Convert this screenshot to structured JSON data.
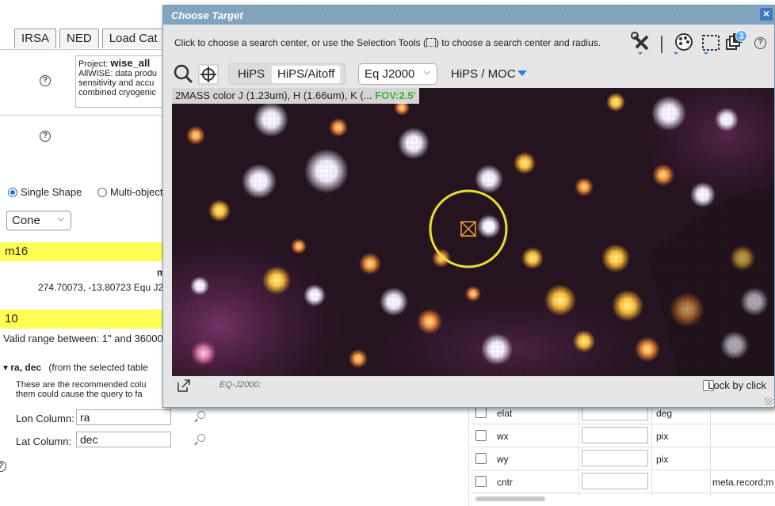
{
  "background": {
    "tabs": [
      "IRSA",
      "NED",
      "Load Cat"
    ],
    "project_label": "Project:",
    "project_name": "wise_all",
    "project_desc": "AllWISE: data produ sensitivity and accu combined cryogenic",
    "shape_options": [
      "Single Shape",
      "Multi-object"
    ],
    "shape_selected": "Single Shape",
    "cone_select": "Cone",
    "target_value": "m16",
    "resolved_m": "m",
    "resolved_coords": "274.70073, -13.80723  Equ J20",
    "radius_value": "10",
    "radius_range": "Valid range between: 1\" and 360000",
    "radec_heading": "ra, dec",
    "radec_note": "(from the selected table",
    "recommended_text_1": "These are the recommended colu",
    "recommended_text_2": "them could cause the query to fa",
    "lon_label": "Lon Column:",
    "lon_value": "ra",
    "lat_label": "Lat Column:",
    "lat_value": "dec",
    "table_rows": [
      {
        "name": "elat",
        "unit": "deg",
        "desc": ""
      },
      {
        "name": "wx",
        "unit": "pix",
        "desc": ""
      },
      {
        "name": "wy",
        "unit": "pix",
        "desc": ""
      },
      {
        "name": "cntr",
        "unit": "",
        "desc": "meta.record;m"
      }
    ]
  },
  "dialog": {
    "title": "Choose Target",
    "close": "×",
    "instructions_before": "Click to choose a search center, or use the Selection Tools (",
    "instructions_after": ") to choose a search center and radius.",
    "layers_badge": "3",
    "help": "?",
    "hips_buttons": [
      "HiPS",
      "HiPS/Aitoff"
    ],
    "hips_selected": "HiPS/Aitoff",
    "coord_select": "Eq J2000",
    "hips_moc": "HiPS / MOC",
    "image_title": "2MASS color J (1.23um), H (1.66um), K (...",
    "fov": "FOV:2.5'",
    "footer_coord": "EQ-J2000:",
    "lock_label": "Lock by click"
  },
  "colors": {
    "title_bar": "#7ea0ba",
    "highlight": "#ffff55",
    "fov": "#3cb035",
    "accent": "#2d7ce0",
    "target_circle": "#e8e030"
  }
}
